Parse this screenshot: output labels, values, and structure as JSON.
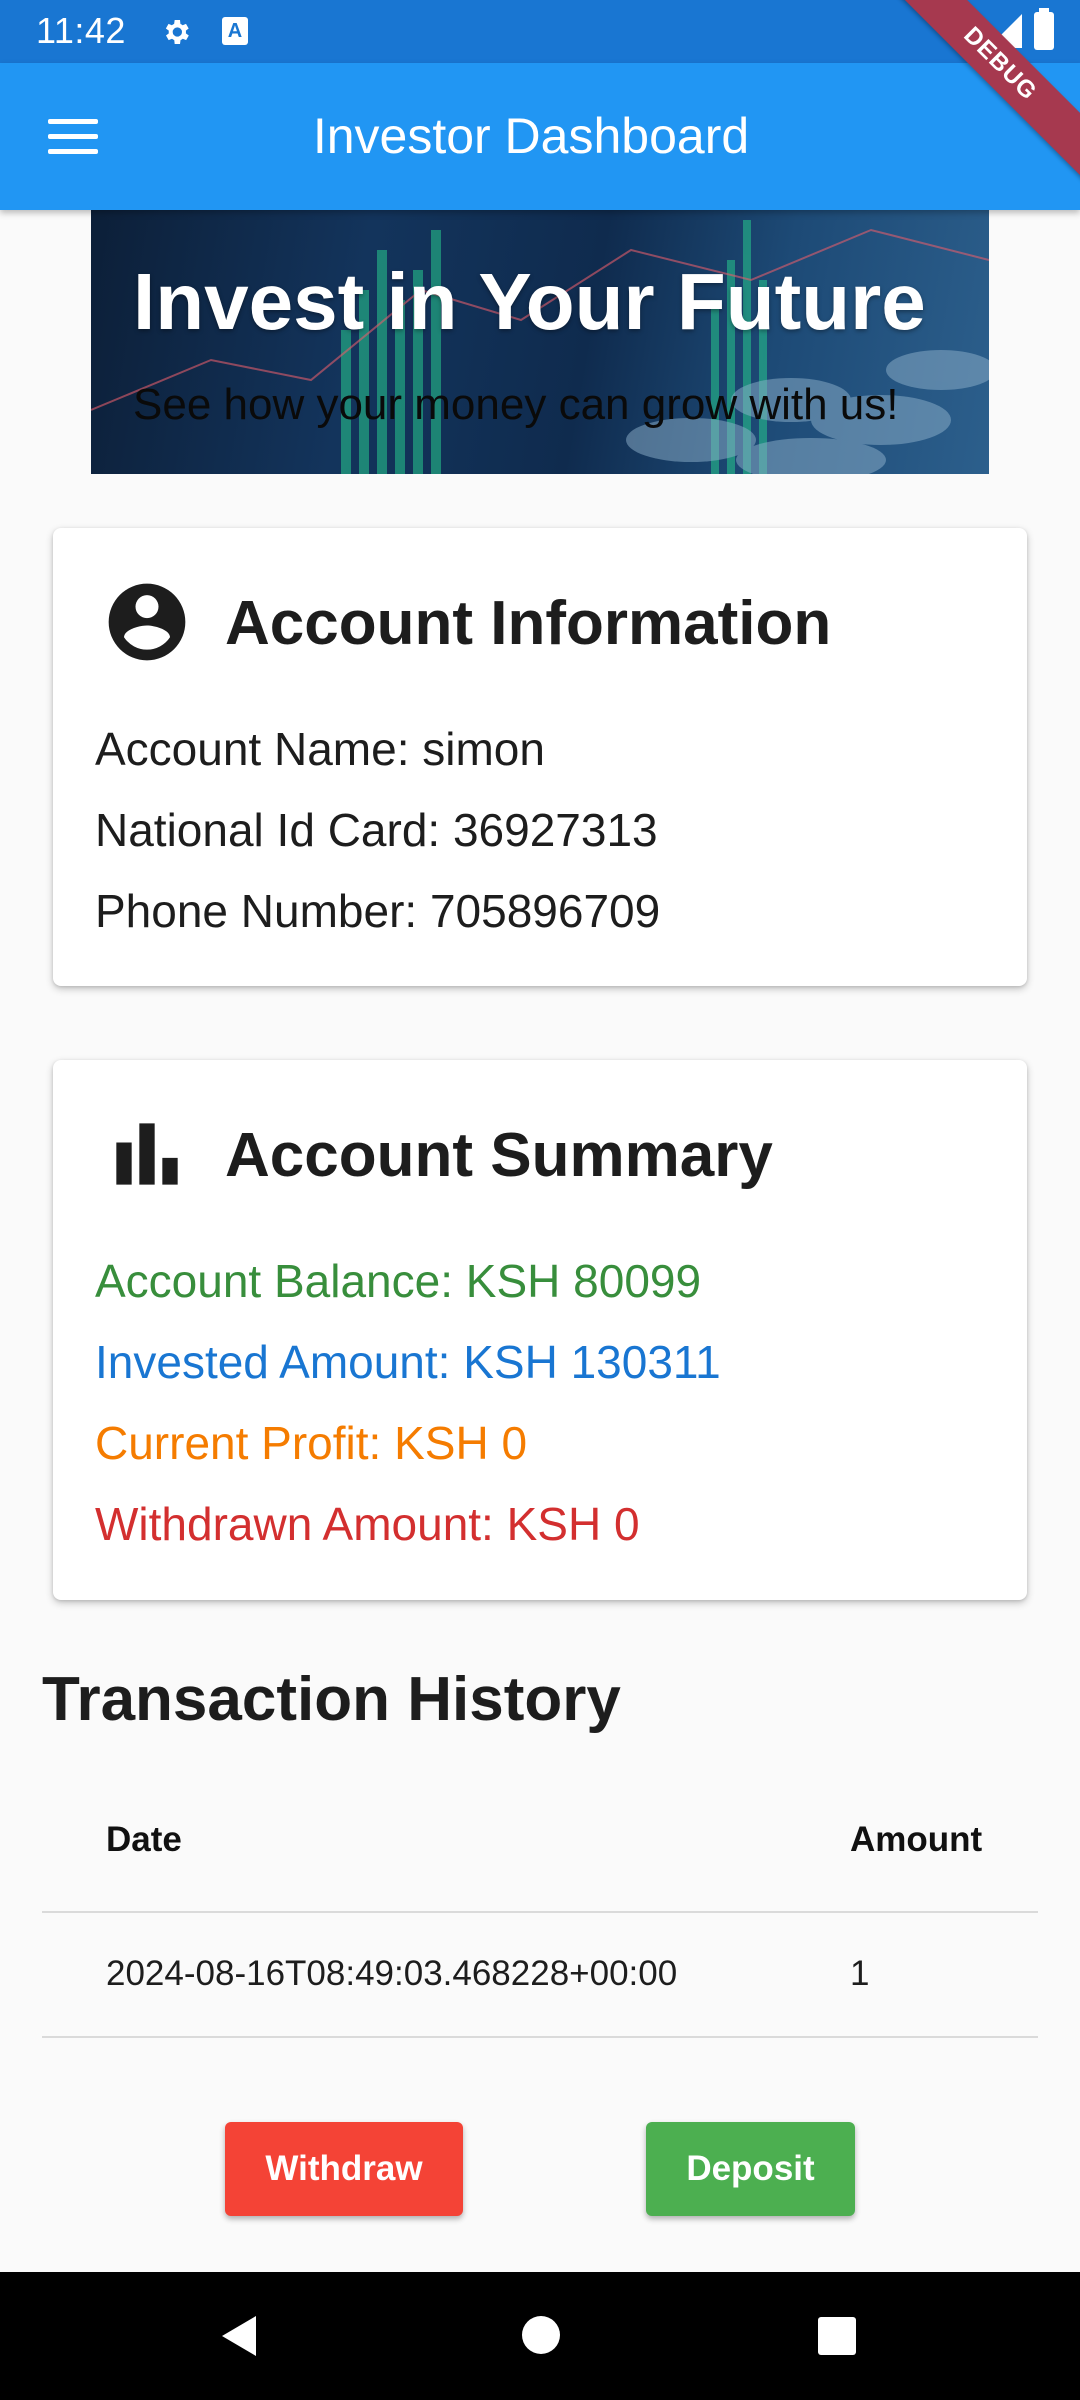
{
  "status_bar": {
    "time": "11:42"
  },
  "app_bar": {
    "title": "Investor Dashboard",
    "debug_label": "DEBUG"
  },
  "banner": {
    "title": "Invest in Your Future",
    "subtitle": "See how your money can grow with us!"
  },
  "account_info": {
    "title": "Account Information",
    "icon": "account-circle-icon",
    "lines": [
      "Account Name: simon",
      "National Id Card: 36927313",
      "Phone Number: 705896709"
    ]
  },
  "account_summary": {
    "title": "Account Summary",
    "icon": "bar-chart-icon",
    "lines": [
      {
        "text": "Account Balance: KSH 80099",
        "color": "#388e3c"
      },
      {
        "text": "Invested Amount: KSH 130311",
        "color": "#1976d2"
      },
      {
        "text": "Current Profit: KSH 0",
        "color": "#f57c00"
      },
      {
        "text": "Withdrawn Amount: KSH 0",
        "color": "#d32f2f"
      }
    ]
  },
  "transactions": {
    "title": "Transaction History",
    "columns": [
      "Date",
      "Amount"
    ],
    "rows": [
      {
        "date": "2024-08-16T08:49:03.468228+00:00",
        "amount": "1"
      }
    ]
  },
  "actions": {
    "withdraw_label": "Withdraw",
    "deposit_label": "Deposit"
  },
  "colors": {
    "app_bar": "#2196f3",
    "status_bar": "#1976d2",
    "withdraw": "#f44336",
    "deposit": "#4caf50"
  }
}
